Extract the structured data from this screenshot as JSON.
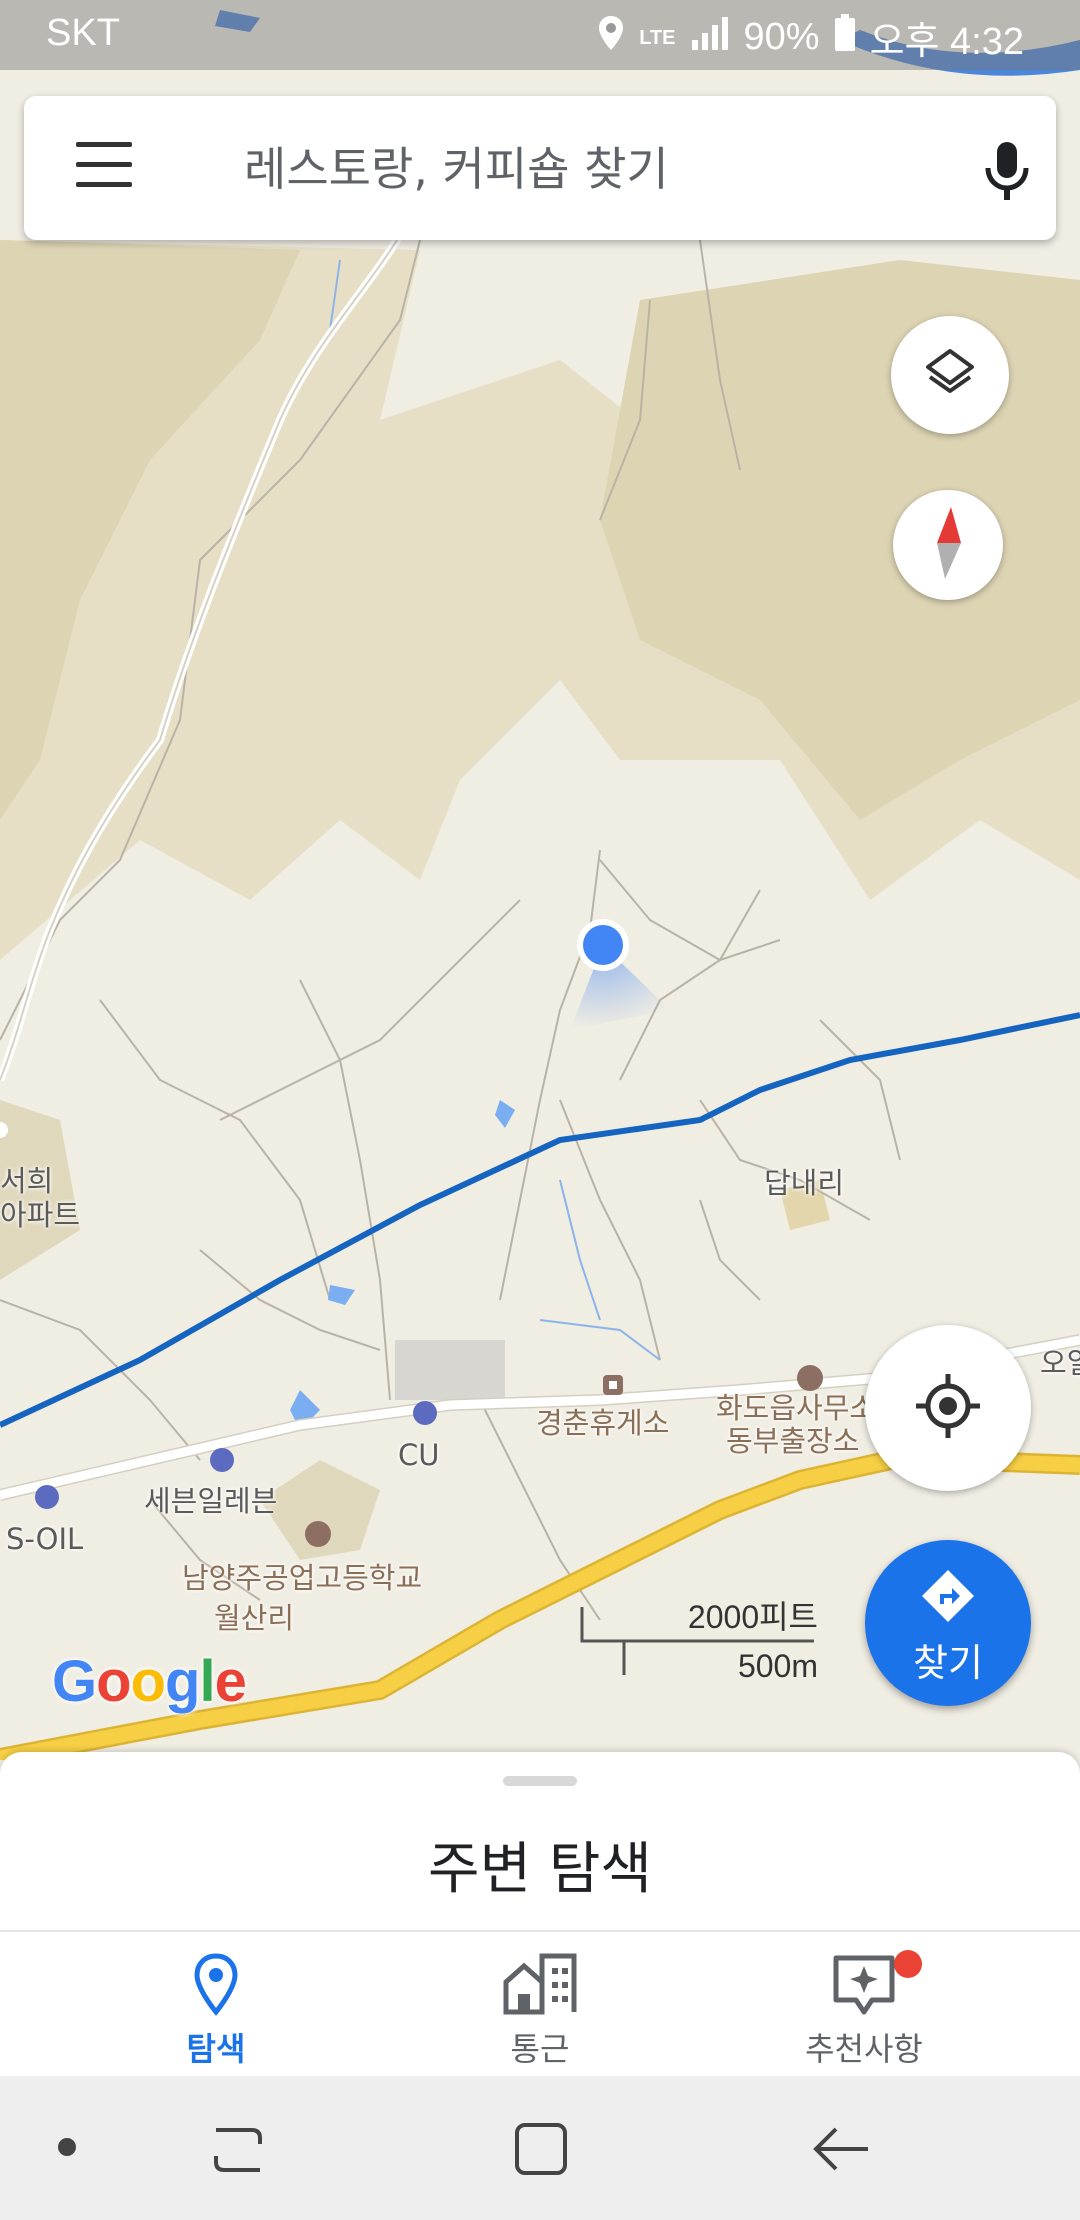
{
  "status_bar": {
    "carrier": "SKT",
    "network": "LTE",
    "battery": "90%",
    "time": "오후 4:32"
  },
  "search": {
    "placeholder": "레스토랑, 커피숍 찾기"
  },
  "map": {
    "labels": {
      "seohui": "서희",
      "apartment": "아파트",
      "dapnae_ri": "답내리",
      "gyeongchun_rest_area": "경춘휴게소",
      "hwado_office": "화도읍사무소",
      "east_branch": "동부출장소",
      "cu": "CU",
      "seven_eleven": "세븐일레븐",
      "s_oil": "S-OIL",
      "namyangju_school": "남양주공업고등학교",
      "wolsan_ri": "월산리",
      "o_edge": "오일"
    },
    "scale": {
      "feet": "2000피트",
      "meters": "500m"
    },
    "logo": {
      "letters": [
        "G",
        "o",
        "o",
        "g",
        "l",
        "e"
      ],
      "colors": [
        "#4285F4",
        "#EA4335",
        "#FBBC05",
        "#4285F4",
        "#34A853",
        "#EA4335"
      ]
    }
  },
  "directions_button": {
    "label": "찾기"
  },
  "bottom_sheet": {
    "title": "주변 탐색"
  },
  "tabs": [
    {
      "label": "탐색",
      "icon": "location-pin-icon",
      "active": true
    },
    {
      "label": "통근",
      "icon": "commute-buildings-icon",
      "active": false
    },
    {
      "label": "추천사항",
      "icon": "sparkle-icon",
      "active": false
    }
  ],
  "colors": {
    "accent": "#1a73e8",
    "badge": "#ea4335",
    "route": "#1565c0",
    "highway": "#f6cf45"
  }
}
